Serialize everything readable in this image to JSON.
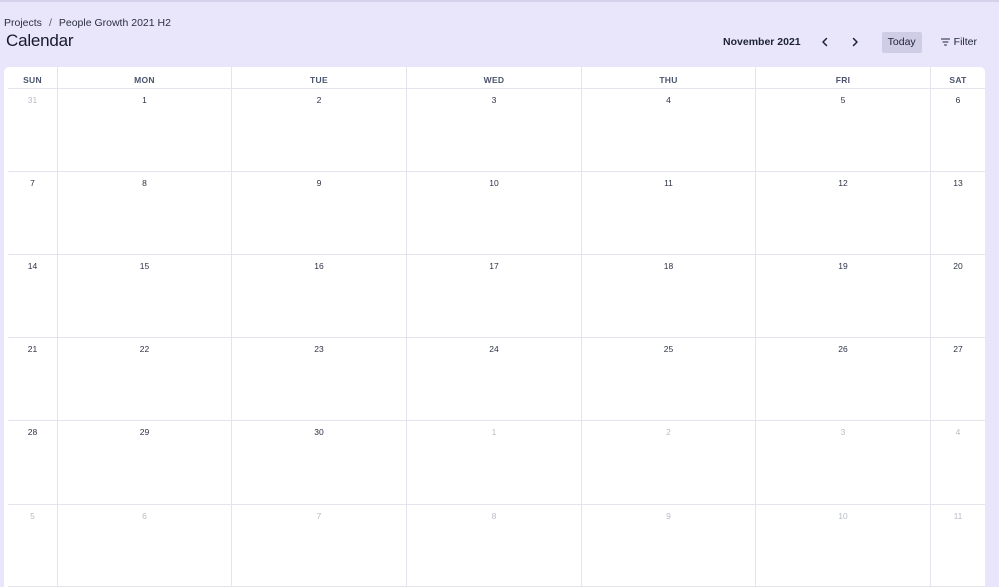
{
  "breadcrumb": {
    "root": "Projects",
    "separator": "/",
    "current": "People Growth 2021 H2"
  },
  "page": {
    "title": "Calendar"
  },
  "toolbar": {
    "month_label": "November 2021",
    "prev_icon": "chevron-left-icon",
    "next_icon": "chevron-right-icon",
    "today_label": "Today",
    "filter_label": "Filter",
    "filter_icon": "filter-icon"
  },
  "calendar": {
    "weekdays": [
      "SUN",
      "MON",
      "TUE",
      "WED",
      "THU",
      "FRI",
      "SAT"
    ],
    "weeks": [
      [
        {
          "day": "31",
          "muted": true
        },
        {
          "day": "1"
        },
        {
          "day": "2"
        },
        {
          "day": "3"
        },
        {
          "day": "4"
        },
        {
          "day": "5"
        },
        {
          "day": "6"
        }
      ],
      [
        {
          "day": "7"
        },
        {
          "day": "8"
        },
        {
          "day": "9"
        },
        {
          "day": "10"
        },
        {
          "day": "11"
        },
        {
          "day": "12"
        },
        {
          "day": "13"
        }
      ],
      [
        {
          "day": "14"
        },
        {
          "day": "15"
        },
        {
          "day": "16"
        },
        {
          "day": "17"
        },
        {
          "day": "18"
        },
        {
          "day": "19"
        },
        {
          "day": "20"
        }
      ],
      [
        {
          "day": "21"
        },
        {
          "day": "22"
        },
        {
          "day": "23"
        },
        {
          "day": "24"
        },
        {
          "day": "25"
        },
        {
          "day": "26"
        },
        {
          "day": "27"
        }
      ],
      [
        {
          "day": "28"
        },
        {
          "day": "29"
        },
        {
          "day": "30"
        },
        {
          "day": "1",
          "muted": true
        },
        {
          "day": "2",
          "muted": true
        },
        {
          "day": "3",
          "muted": true
        },
        {
          "day": "4",
          "muted": true
        }
      ],
      [
        {
          "day": "5",
          "muted": true
        },
        {
          "day": "6",
          "muted": true
        },
        {
          "day": "7",
          "muted": true
        },
        {
          "day": "8",
          "muted": true
        },
        {
          "day": "9",
          "muted": true
        },
        {
          "day": "10",
          "muted": true
        },
        {
          "day": "11",
          "muted": true
        }
      ]
    ]
  },
  "colors": {
    "background": "#e9e6fb",
    "today_button": "#cfcde5",
    "muted_day": "#b9bcc8",
    "grid_line": "#e4e4ec"
  }
}
